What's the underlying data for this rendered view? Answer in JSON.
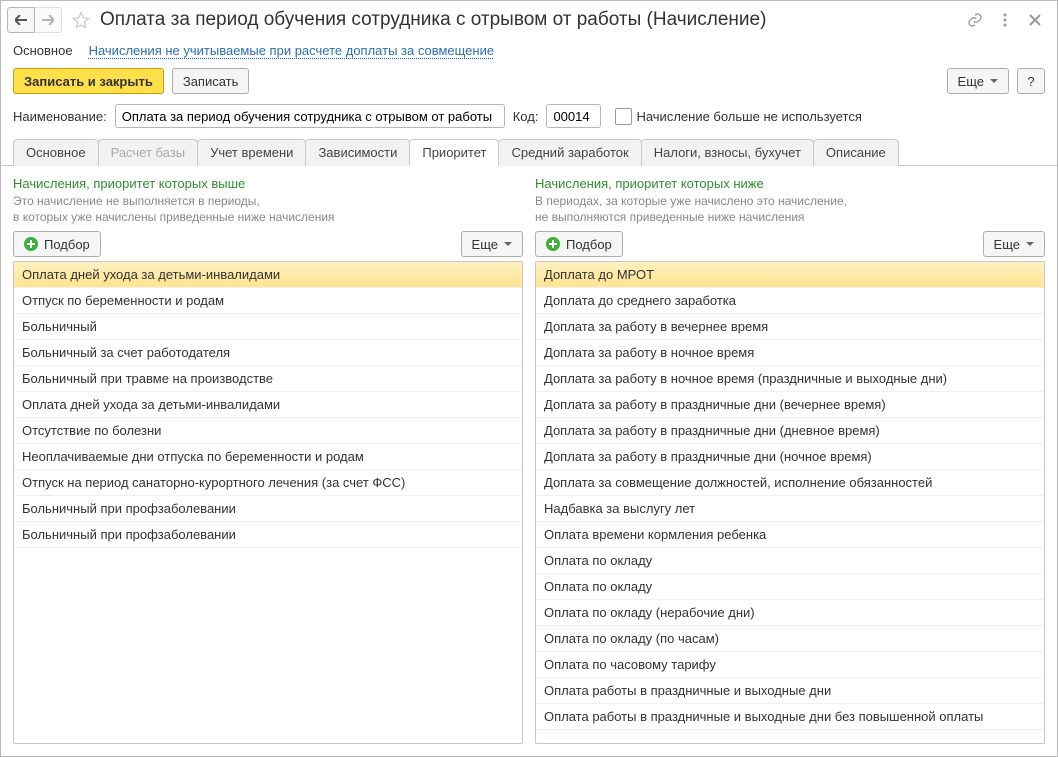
{
  "header": {
    "title": "Оплата за период обучения сотрудника с отрывом от работы (Начисление)"
  },
  "secbar": {
    "main": "Основное",
    "link": "Начисления не учитываемые при расчете доплаты за совмещение"
  },
  "toolbar": {
    "save_close": "Записать и закрыть",
    "save": "Записать",
    "more": "Еще",
    "help": "?"
  },
  "form": {
    "name_label": "Наименование:",
    "name_value": "Оплата за период обучения сотрудника с отрывом от работы",
    "code_label": "Код:",
    "code_value": "00014",
    "unused_label": "Начисление больше не используется"
  },
  "tabs": [
    {
      "label": "Основное"
    },
    {
      "label": "Расчет базы",
      "disabled": true
    },
    {
      "label": "Учет времени"
    },
    {
      "label": "Зависимости"
    },
    {
      "label": "Приоритет",
      "active": true
    },
    {
      "label": "Средний заработок"
    },
    {
      "label": "Налоги, взносы, бухучет"
    },
    {
      "label": "Описание"
    }
  ],
  "left": {
    "title": "Начисления, приоритет которых выше",
    "desc": "Это начисление не выполняется в периоды,\nв которых уже начислены приведенные ниже начисления",
    "pick": "Подбор",
    "more": "Еще",
    "items": [
      "Оплата дней ухода за детьми-инвалидами",
      "Отпуск по беременности и родам",
      "Больничный",
      "Больничный за счет работодателя",
      "Больничный при травме на производстве",
      "Оплата дней ухода за детьми-инвалидами",
      "Отсутствие по болезни",
      "Неоплачиваемые дни отпуска по беременности и родам",
      "Отпуск на период санаторно-курортного лечения (за счет ФСС)",
      "Больничный при профзаболевании",
      "Больничный при профзаболевании"
    ]
  },
  "right": {
    "title": "Начисления, приоритет которых ниже",
    "desc": "В периодах, за которые уже начислено это начисление,\nне выполняются приведенные ниже начисления",
    "pick": "Подбор",
    "more": "Еще",
    "items": [
      "Доплата до МРОТ",
      "Доплата до среднего заработка",
      "Доплата за работу в вечернее время",
      "Доплата за работу в ночное время",
      "Доплата за работу в ночное время (праздничные и выходные дни)",
      "Доплата за работу в праздничные дни (вечернее время)",
      "Доплата за работу в праздничные дни (дневное время)",
      "Доплата за работу в праздничные дни (ночное время)",
      "Доплата за совмещение должностей, исполнение обязанностей",
      "Надбавка за выслугу лет",
      "Оплата времени кормления ребенка",
      "Оплата по окладу",
      "Оплата по окладу",
      "Оплата по окладу (нерабочие дни)",
      "Оплата по окладу (по часам)",
      "Оплата по часовому тарифу",
      "Оплата работы в праздничные и выходные дни",
      "Оплата работы в праздничные и выходные дни без повышенной оплаты"
    ]
  }
}
